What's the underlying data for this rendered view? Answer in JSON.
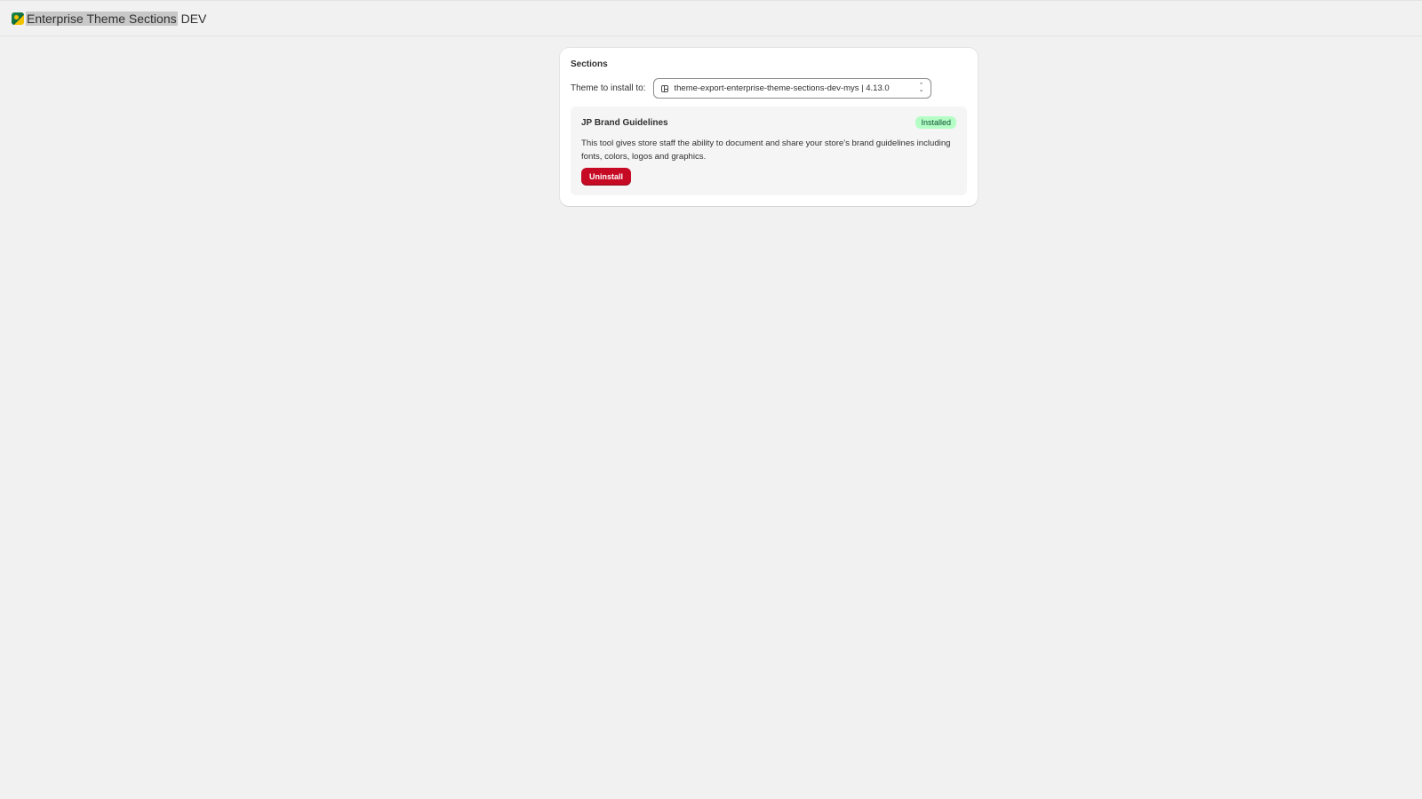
{
  "app": {
    "name": "Enterprise Theme Sections",
    "env": "DEV"
  },
  "card": {
    "title": "Sections",
    "theme_label": "Theme to install to:",
    "theme_value": "theme-export-enterprise-theme-sections-dev-mys | 4.13.0",
    "theme_icon": "theme-icon"
  },
  "section": {
    "name": "JP Brand Guidelines",
    "status": "Installed",
    "description": "This tool gives store staff the ability to document and share your store's brand guidelines including fonts, colors, logos and graphics.",
    "action_label": "Uninstall"
  },
  "colors": {
    "background": "#f1f1f1",
    "danger": "#c70a24",
    "success_badge": "#b4fec6"
  }
}
